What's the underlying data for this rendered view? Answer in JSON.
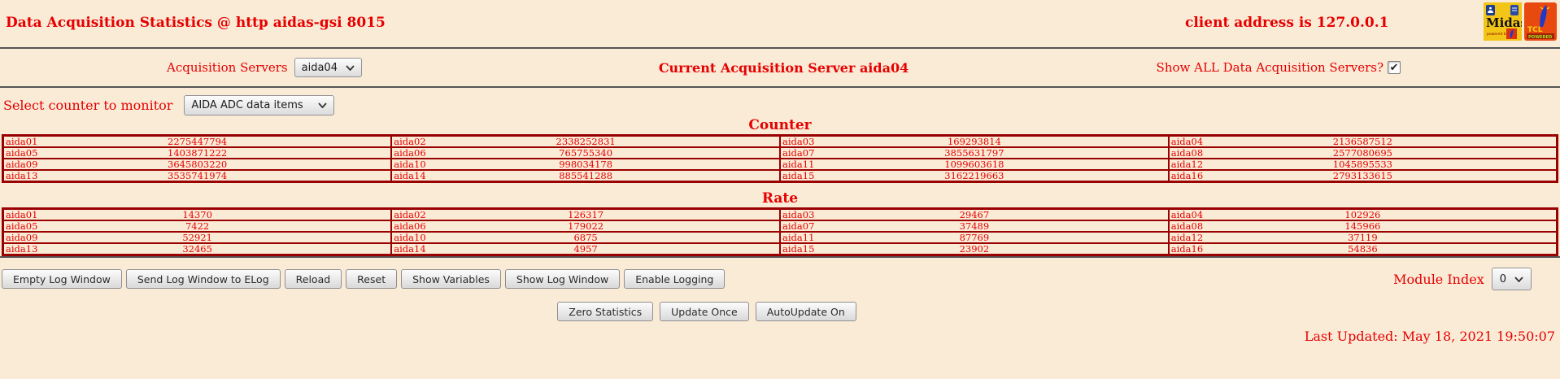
{
  "page": {
    "title": "Data Acquisition Statistics @ http aidas-gsi 8015",
    "client_address": "client address is 127.0.0.1",
    "last_updated": "Last Updated: May 18, 2021 19:50:07"
  },
  "logos": {
    "midas_label": "Midas",
    "midas_powered": "powered by",
    "tcl_label": "TCL",
    "tcl_powered": "POWERED"
  },
  "acquisition": {
    "servers_label": "Acquisition Servers",
    "server_select_value": "aida04",
    "current_server_text": "Current Acquisition Server aida04",
    "show_all_label": "Show ALL Data Acquisition Servers?",
    "show_all_checked": true,
    "checkmark": "✔"
  },
  "counter_select": {
    "label": "Select counter to monitor",
    "value": "AIDA ADC data items"
  },
  "counter_table": {
    "title": "Counter",
    "rows": [
      [
        [
          "aida01",
          "2275447794"
        ],
        [
          "aida02",
          "2338252831"
        ],
        [
          "aida03",
          "169293814"
        ],
        [
          "aida04",
          "2136587512"
        ]
      ],
      [
        [
          "aida05",
          "1403871222"
        ],
        [
          "aida06",
          "765755340"
        ],
        [
          "aida07",
          "3855631797"
        ],
        [
          "aida08",
          "2577080695"
        ]
      ],
      [
        [
          "aida09",
          "3645803220"
        ],
        [
          "aida10",
          "998034178"
        ],
        [
          "aida11",
          "1099603618"
        ],
        [
          "aida12",
          "1045895533"
        ]
      ],
      [
        [
          "aida13",
          "3535741974"
        ],
        [
          "aida14",
          "885541288"
        ],
        [
          "aida15",
          "3162219663"
        ],
        [
          "aida16",
          "2793133615"
        ]
      ]
    ]
  },
  "rate_table": {
    "title": "Rate",
    "rows": [
      [
        [
          "aida01",
          "14370"
        ],
        [
          "aida02",
          "126317"
        ],
        [
          "aida03",
          "29467"
        ],
        [
          "aida04",
          "102926"
        ]
      ],
      [
        [
          "aida05",
          "7422"
        ],
        [
          "aida06",
          "179022"
        ],
        [
          "aida07",
          "37489"
        ],
        [
          "aida08",
          "145966"
        ]
      ],
      [
        [
          "aida09",
          "52921"
        ],
        [
          "aida10",
          "6875"
        ],
        [
          "aida11",
          "87769"
        ],
        [
          "aida12",
          "37119"
        ]
      ],
      [
        [
          "aida13",
          "32465"
        ],
        [
          "aida14",
          "4957"
        ],
        [
          "aida15",
          "23902"
        ],
        [
          "aida16",
          "54836"
        ]
      ]
    ]
  },
  "toolbar": {
    "buttons": [
      "Empty Log Window",
      "Send Log Window to ELog",
      "Reload",
      "Reset",
      "Show Variables",
      "Show Log Window",
      "Enable Logging"
    ],
    "module_index_label": "Module Index",
    "module_index_value": "0"
  },
  "actions": {
    "buttons": [
      "Zero Statistics",
      "Update Once",
      "AutoUpdate On"
    ]
  },
  "colors": {
    "background": "#faebd7",
    "text_red": "#e60000",
    "border_red": "#990000"
  }
}
